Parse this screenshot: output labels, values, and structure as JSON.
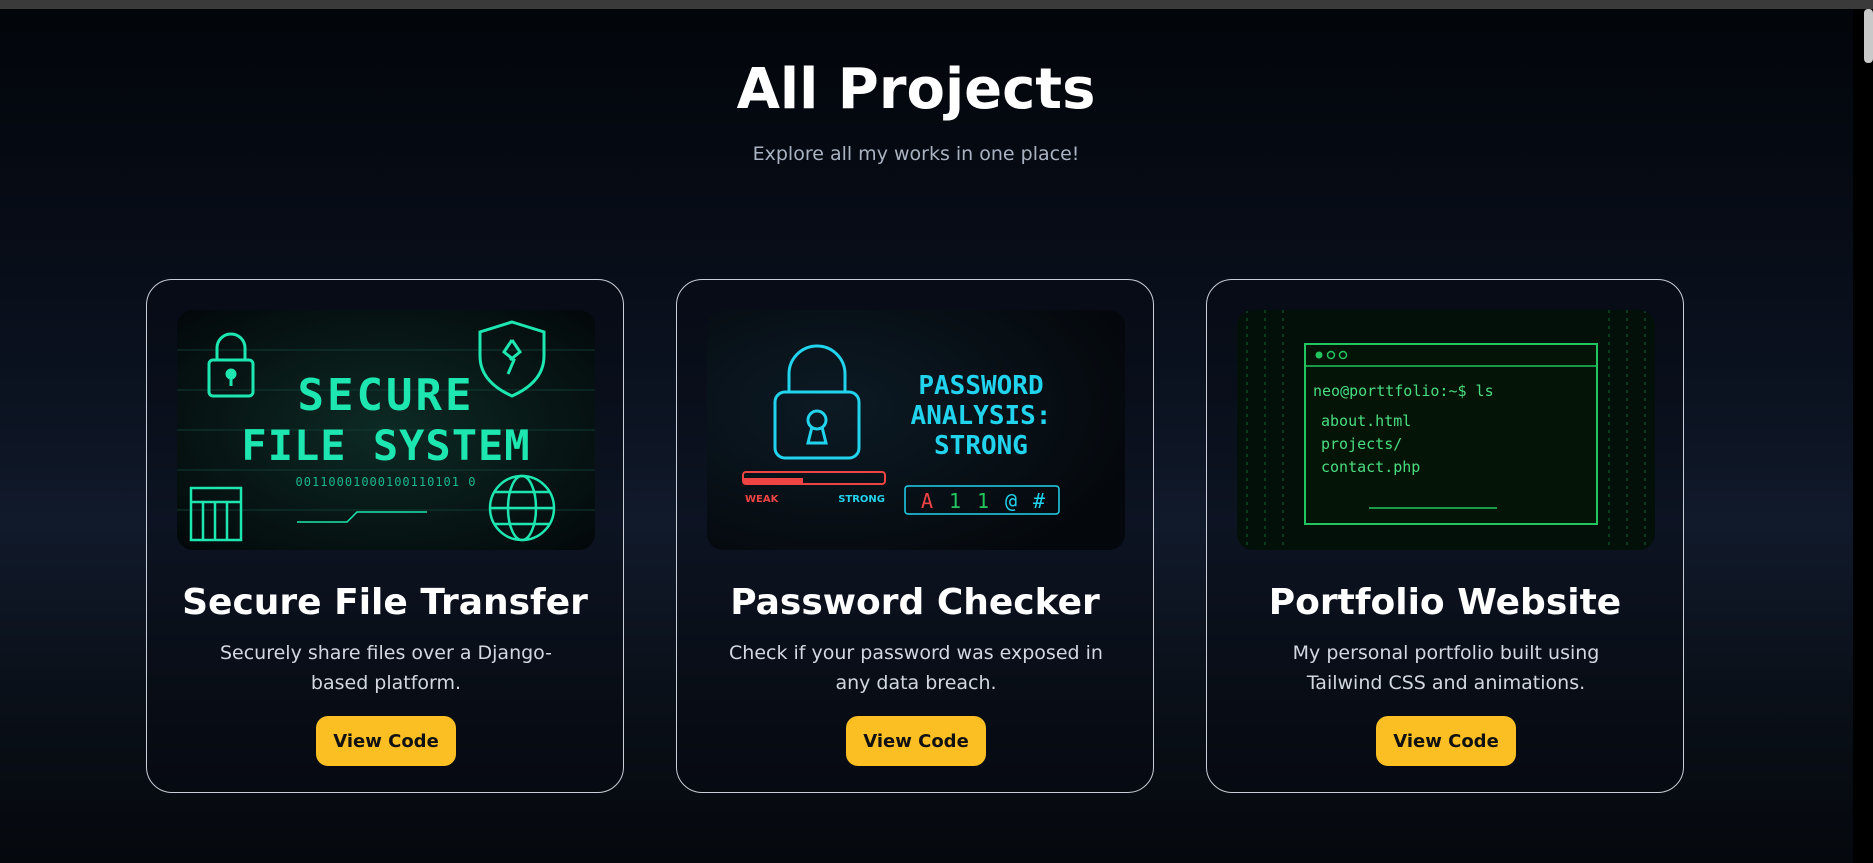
{
  "header": {
    "title": "All Projects",
    "subtitle": "Explore all my works in one place!"
  },
  "projects": [
    {
      "title": "Secure File Transfer",
      "description": "Securely share files over a Django-based platform.",
      "button_label": "View Code",
      "image": {
        "line1": "SECURE",
        "line2": "FILE SYSTEM",
        "binary": "00110001000100110101 0",
        "icons": [
          "lock-icon",
          "shield-icon",
          "globe-icon",
          "server-icon"
        ]
      }
    },
    {
      "title": "Password Checker",
      "description": "Check if your password was exposed in any data breach.",
      "button_label": "View Code",
      "image": {
        "line1": "PASSWORD",
        "line2": "ANALYSIS:",
        "line3": "STRONG",
        "weak_label": "WEAK",
        "strong_label": "STRONG",
        "chars": [
          "A",
          "1",
          "1",
          "@",
          "#"
        ],
        "icons": [
          "padlock-icon"
        ]
      }
    },
    {
      "title": "Portfolio Website",
      "description": "My personal portfolio built using Tailwind CSS and animations.",
      "button_label": "View Code",
      "image": {
        "prompt": "neo@porttfolio:~$ ls",
        "files": [
          "about.html",
          "projects/",
          "contact.php"
        ]
      }
    }
  ],
  "colors": {
    "accent_button": "#fbbf24",
    "neon_teal": "#1ee6b0",
    "neon_cyan": "#22d3ee",
    "neon_green": "#22c55e",
    "neon_red": "#ef4444"
  }
}
